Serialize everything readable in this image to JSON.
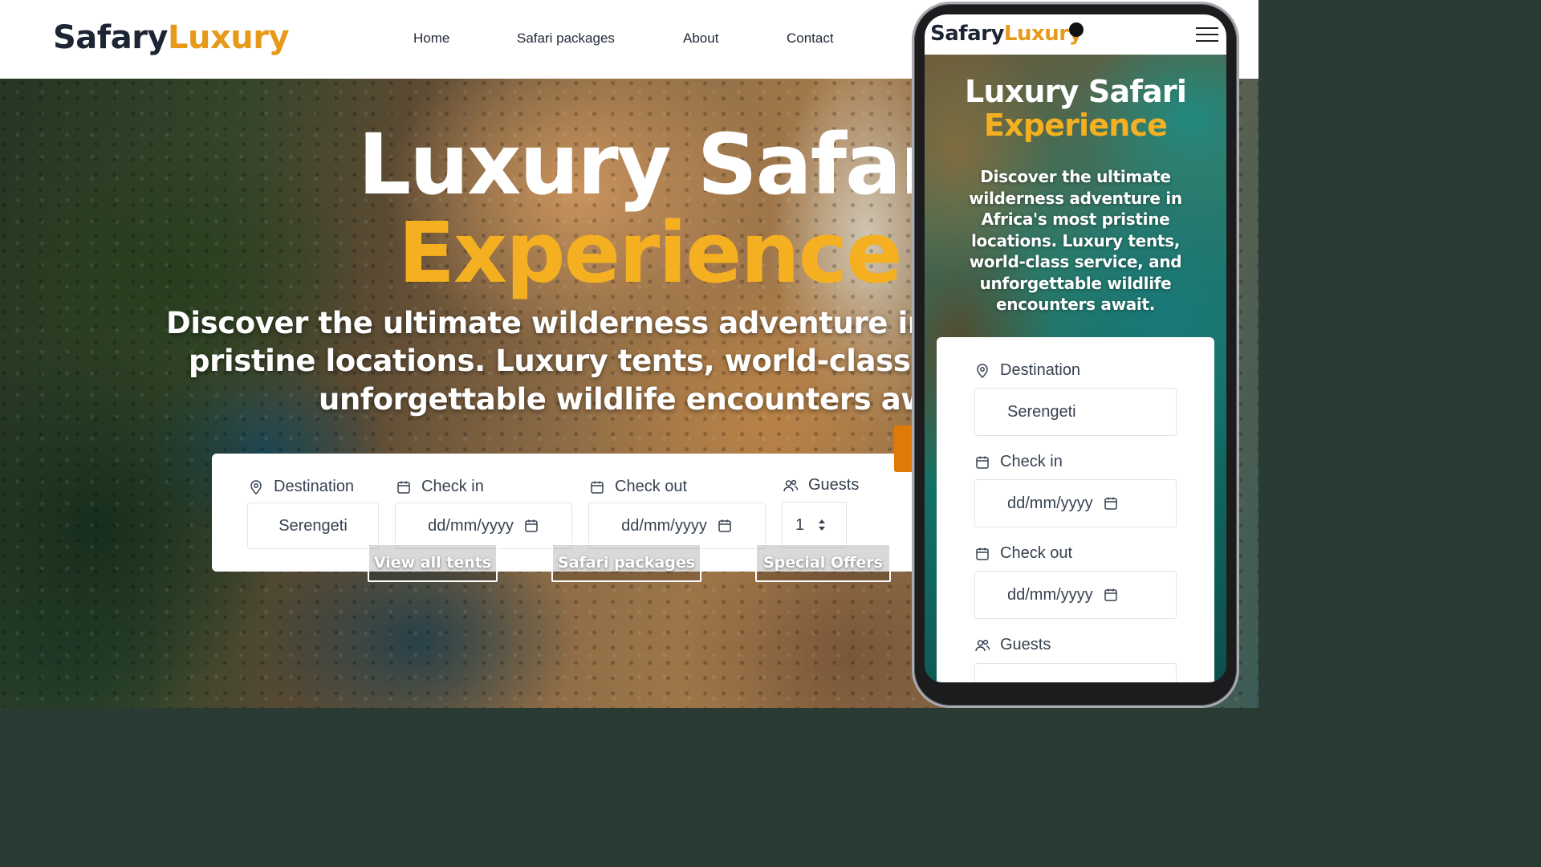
{
  "brand": {
    "part1": "Safary",
    "part2": "Luxury"
  },
  "nav": [
    "Home",
    "Safari packages",
    "About",
    "Contact"
  ],
  "hero": {
    "title_line1": "Luxury Safari",
    "title_line2": "Experience",
    "subtitle_lines": [
      "Discover the ultimate wilderness adventure in A",
      "pristine locations. Luxury tents, world-class se",
      "unforgettable wildlife encounters awa"
    ]
  },
  "search": {
    "destination_label": "Destination",
    "destination_value": "Serengeti",
    "checkin_label": "Check in",
    "checkin_value": "dd/mm/yyyy",
    "checkout_label": "Check out",
    "checkout_value": "dd/mm/yyyy",
    "guests_label": "Guests",
    "guests_value": "1"
  },
  "buttons": [
    "View all tents",
    "Safari packages",
    "Special Offers"
  ],
  "mobile": {
    "title_line1": "Luxury Safari",
    "title_line2": "Experience",
    "subtitle_lines": [
      "Discover the ultimate",
      "wilderness adventure in",
      "Africa's most pristine",
      "locations. Luxury tents,",
      "world-class service, and",
      "unforgettable wildlife",
      "encounters await."
    ],
    "destination_label": "Destination",
    "destination_value": "Serengeti",
    "checkin_label": "Check in",
    "checkin_value": "dd/mm/yyyy",
    "checkout_label": "Check out",
    "checkout_value": "dd/mm/yyyy",
    "guests_label": "Guests"
  },
  "colors": {
    "brand_dark": "#1d2433",
    "brand_accent": "#e79a1a",
    "title_accent": "#f5b021",
    "search_button": "#e07a06"
  },
  "icons": [
    "map-pin-icon",
    "calendar-icon",
    "users-icon",
    "spinner-arrows-icon",
    "hamburger-menu-icon"
  ]
}
